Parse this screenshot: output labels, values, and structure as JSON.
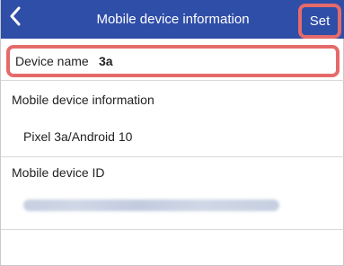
{
  "header": {
    "title": "Mobile device information",
    "set_label": "Set",
    "back_icon": "chevron-left-icon"
  },
  "device_name": {
    "label": "Device name",
    "value": "3a"
  },
  "mobile_info": {
    "label": "Mobile device information",
    "value": "Pixel 3a/Android 10"
  },
  "mobile_id": {
    "label": "Mobile device ID"
  },
  "colors": {
    "header_bg": "#2f4ea7",
    "highlight": "#e56a6a",
    "text": "#222222"
  }
}
